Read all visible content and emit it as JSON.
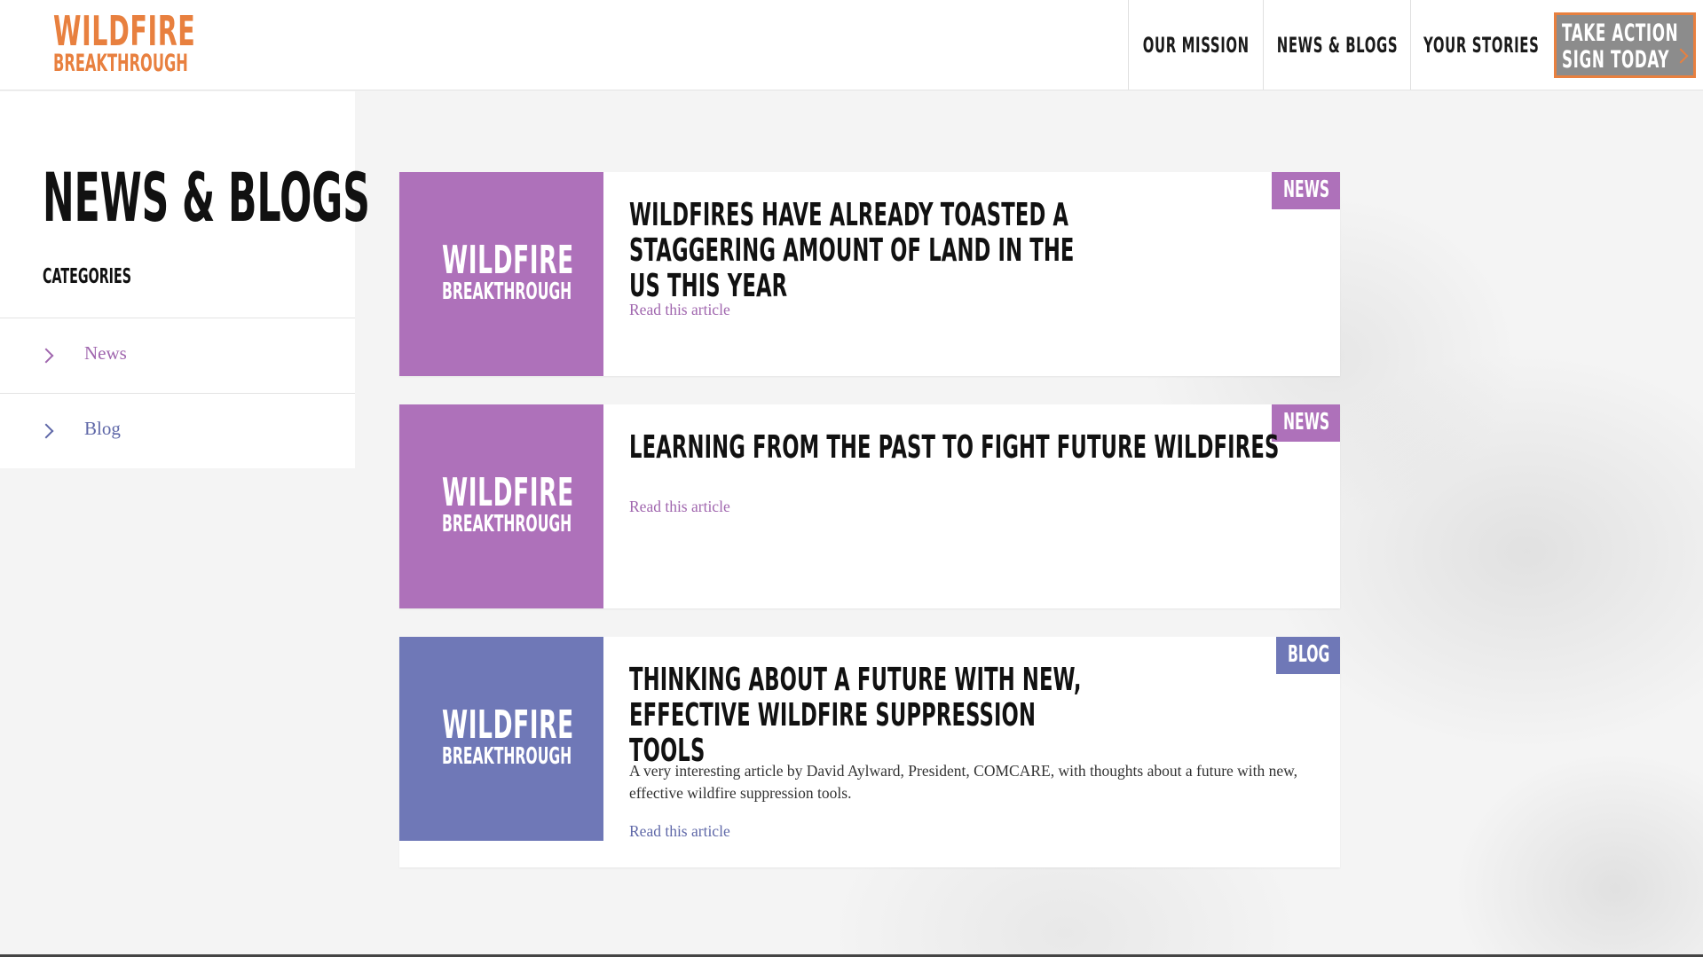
{
  "logo": {
    "line1": "WILDFIRE",
    "line2": "BREAKTHROUGH"
  },
  "nav": {
    "items": [
      {
        "label": "OUR MISSION"
      },
      {
        "label": "NEWS & BLOGS"
      },
      {
        "label": "YOUR STORIES"
      }
    ],
    "cta": {
      "line1": "TAKE ACTION",
      "line2": "SIGN TODAY"
    }
  },
  "sidebar": {
    "title": "NEWS & BLOGS",
    "categories_label": "CATEGORIES",
    "categories": [
      {
        "label": "News",
        "color": "#a066ae"
      },
      {
        "label": "Blog",
        "color": "#5f68a8"
      }
    ]
  },
  "colors": {
    "brand_orange": "#e8803f",
    "news_purple": "#ae71ba",
    "blog_blue": "#6f78b7"
  },
  "thumb_text": {
    "line1": "WILDFIRE",
    "line2": "BREAKTHROUGH"
  },
  "articles": [
    {
      "category": "NEWS",
      "title": "WILDFIRES HAVE ALREADY TOASTED A STAGGERING AMOUNT OF LAND IN THE US THIS YEAR",
      "excerpt": "",
      "link": "Read this article"
    },
    {
      "category": "NEWS",
      "title": "LEARNING FROM THE PAST TO FIGHT FUTURE WILDFIRES",
      "excerpt": "",
      "link": "Read this article"
    },
    {
      "category": "BLOG",
      "title": "THINKING ABOUT A FUTURE WITH NEW, EFFECTIVE WILDFIRE SUPPRESSION TOOLS",
      "excerpt": "A very interesting article by David Aylward, President, COMCARE, with thoughts about a future with new, effective wildfire suppression tools.",
      "link": "Read this article"
    }
  ]
}
